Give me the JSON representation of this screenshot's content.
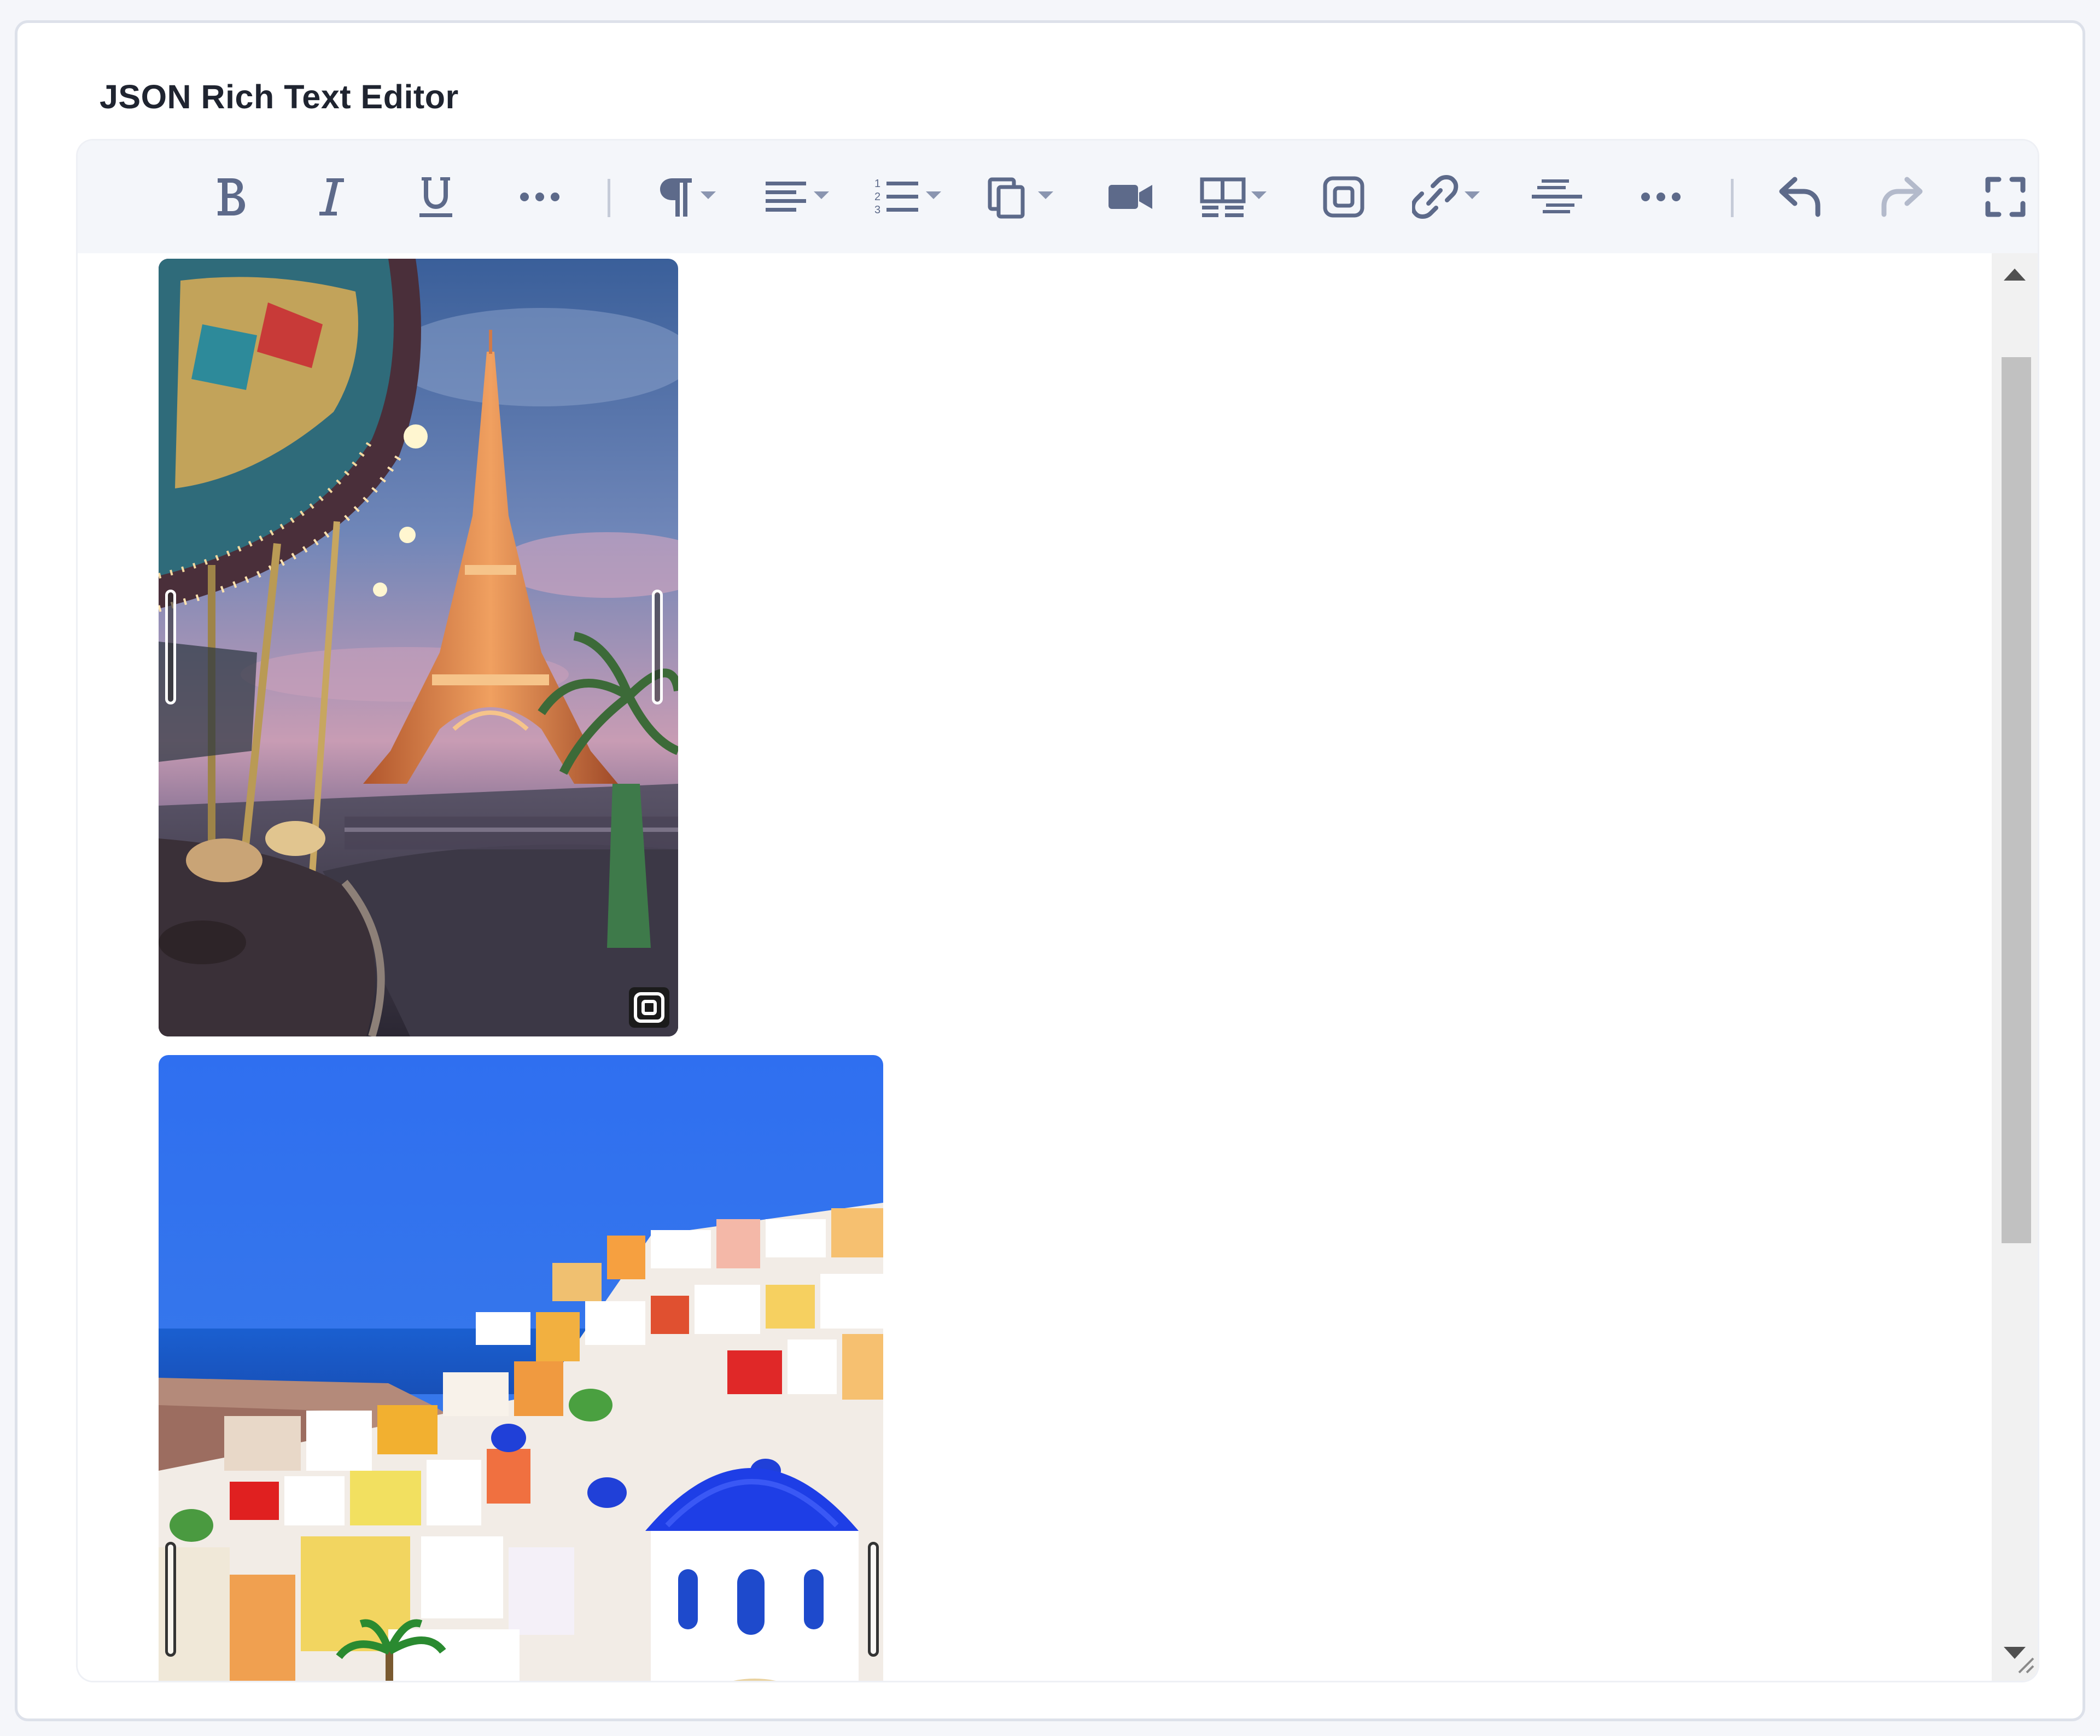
{
  "card": {
    "title": "JSON Rich Text Editor"
  },
  "toolbar": {
    "buttons": [
      {
        "name": "bold",
        "icon": "bold-icon"
      },
      {
        "name": "italic",
        "icon": "italic-icon"
      },
      {
        "name": "underline",
        "icon": "underline-icon"
      },
      {
        "name": "more-text",
        "icon": "more-dots-icon"
      },
      {
        "name": "paragraph",
        "icon": "paragraph-icon",
        "dropdown": true
      },
      {
        "name": "align",
        "icon": "align-left-icon",
        "dropdown": true
      },
      {
        "name": "list",
        "icon": "ordered-list-icon",
        "dropdown": true
      },
      {
        "name": "paste",
        "icon": "paste-icon",
        "dropdown": true
      },
      {
        "name": "video",
        "icon": "video-icon"
      },
      {
        "name": "table",
        "icon": "table-icon",
        "dropdown": true
      },
      {
        "name": "embed",
        "icon": "embed-icon"
      },
      {
        "name": "link",
        "icon": "link-icon",
        "dropdown": true
      },
      {
        "name": "strikethrough",
        "icon": "strikethrough-icon"
      },
      {
        "name": "more-insert",
        "icon": "more-dots-icon"
      },
      {
        "name": "undo",
        "icon": "undo-icon"
      },
      {
        "name": "redo",
        "icon": "redo-icon"
      },
      {
        "name": "fullscreen",
        "icon": "fullscreen-icon"
      }
    ]
  },
  "content": {
    "images": [
      {
        "name": "eiffel-tower-carousel-image",
        "subject": "Eiffel Tower at dusk with carousel"
      },
      {
        "name": "santorini-village-image",
        "subject": "Santorini village with blue dome"
      }
    ]
  },
  "colors": {
    "icon": "#5d6a8a",
    "toolbar_bg": "#f4f6fa",
    "border": "#dde1ea",
    "scroll_thumb": "#c1c1c1"
  }
}
